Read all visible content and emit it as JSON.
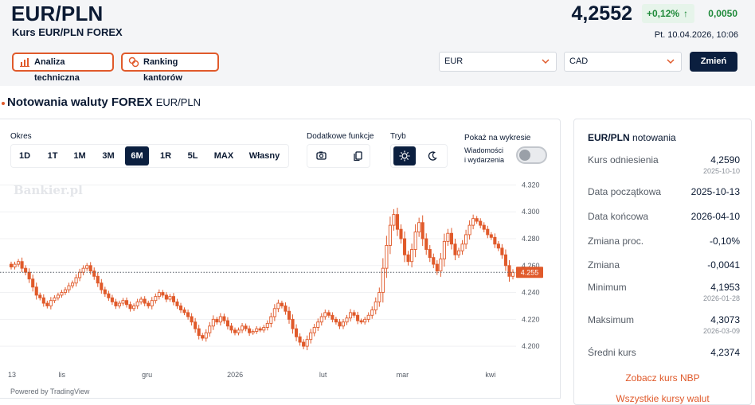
{
  "header": {
    "ticker": "EUR/PLN",
    "subtitle": "Kurs EUR/PLN FOREX",
    "price": "4,2552",
    "change_pct": "+0,12%",
    "change_abs": "0,0050",
    "datetime": "Pt. 10.04.2026, 10:06",
    "btn_analysis": "Analiza techniczna",
    "btn_ranking": "Ranking kantorów",
    "select_from": "EUR",
    "select_to": "CAD",
    "btn_change": "Zmień"
  },
  "section": {
    "title": "Notowania waluty FOREX",
    "symbol": "EUR/PLN"
  },
  "controls": {
    "period_label": "Okres",
    "periods": [
      "1D",
      "1T",
      "1M",
      "3M",
      "6M",
      "1R",
      "5L",
      "MAX",
      "Własny"
    ],
    "active_period": "6M",
    "extra_label": "Dodatkowe funkcje",
    "mode_label": "Tryb",
    "show_label": "Pokaż na wykresie",
    "news_label_1": "Wiadomości",
    "news_label_2": "i wydarzenia"
  },
  "watermark": "Bankier.pl",
  "powered_by": "Powered by TradingView",
  "chart_data": {
    "type": "candlestick",
    "current_label": "4.255",
    "y_ticks": [
      "4.320",
      "4.300",
      "4.280",
      "4.260",
      "4.240",
      "4.220",
      "4.200"
    ],
    "ylim": [
      4.19,
      4.325
    ],
    "x_labels": [
      "13",
      "lis",
      "gru",
      "2026",
      "lut",
      "mar",
      "kwi"
    ],
    "x_label_dates": [
      "2025-10-13",
      "2025-11-01",
      "2025-12-01",
      "2026-01-01",
      "2026-02-01",
      "2026-03-01",
      "2026-04-01"
    ],
    "date_range": [
      "2025-10-13",
      "2026-04-10"
    ],
    "closes": [
      4.259,
      4.261,
      4.263,
      4.258,
      4.255,
      4.25,
      4.244,
      4.238,
      4.236,
      4.232,
      4.23,
      4.234,
      4.236,
      4.238,
      4.24,
      4.242,
      4.245,
      4.247,
      4.251,
      4.255,
      4.258,
      4.26,
      4.256,
      4.252,
      4.247,
      4.242,
      4.239,
      4.236,
      4.233,
      4.23,
      4.232,
      4.234,
      4.231,
      4.228,
      4.23,
      4.233,
      4.235,
      4.232,
      4.23,
      4.234,
      4.237,
      4.24,
      4.238,
      4.235,
      4.237,
      4.233,
      4.23,
      4.227,
      4.225,
      4.222,
      4.218,
      4.213,
      4.208,
      4.206,
      4.21,
      4.215,
      4.22,
      4.218,
      4.222,
      4.219,
      4.215,
      4.212,
      4.21,
      4.212,
      4.215,
      4.213,
      4.21,
      4.211,
      4.213,
      4.212,
      4.214,
      4.217,
      4.222,
      4.228,
      4.232,
      4.23,
      4.226,
      4.22,
      4.213,
      4.207,
      4.203,
      4.2,
      4.205,
      4.21,
      4.214,
      4.218,
      4.222,
      4.225,
      4.223,
      4.22,
      4.218,
      4.215,
      4.218,
      4.221,
      4.225,
      4.223,
      4.219,
      4.218,
      4.22,
      4.223,
      4.227,
      4.233,
      4.24,
      4.258,
      4.275,
      4.29,
      4.298,
      4.287,
      4.28,
      4.268,
      4.263,
      4.272,
      4.285,
      4.292,
      4.28,
      4.272,
      4.266,
      4.261,
      4.256,
      4.265,
      4.278,
      4.284,
      4.276,
      4.268,
      4.271,
      4.276,
      4.283,
      4.29,
      4.295,
      4.293,
      4.29,
      4.287,
      4.283,
      4.281,
      4.276,
      4.273,
      4.268,
      4.26,
      4.252,
      4.255
    ]
  },
  "sidebar": {
    "title_symbol": "EUR/PLN",
    "title_rest": "notowania",
    "rows": [
      {
        "label": "Kurs odniesienia",
        "value": "4,2590",
        "date": "2025-10-10"
      },
      {
        "label": "Data początkowa",
        "value": "2025-10-13",
        "date": ""
      },
      {
        "label": "Data końcowa",
        "value": "2026-04-10",
        "date": ""
      },
      {
        "label": "Zmiana proc.",
        "value": "-0,10%",
        "date": ""
      },
      {
        "label": "Zmiana",
        "value": "-0,0041",
        "date": ""
      },
      {
        "label": "Minimum",
        "value": "4,1953",
        "date": "2026-01-28"
      },
      {
        "label": "Maksimum",
        "value": "4,3073",
        "date": "2026-03-09"
      },
      {
        "label": "Średni kurs",
        "value": "4,2374",
        "date": ""
      }
    ],
    "link_nbp": "Zobacz kurs NBP",
    "link_more": "Wszystkie kursy walut"
  },
  "colors": {
    "accent": "#e05a2b",
    "dark": "#0b1f3f",
    "positive": "#1f8a3a",
    "candle": "#e05a2b"
  },
  "icons": [
    "bar-chart-icon",
    "coins-icon",
    "chevron-down-icon",
    "camera-icon",
    "copy-icon",
    "sun-icon",
    "moon-icon"
  ]
}
